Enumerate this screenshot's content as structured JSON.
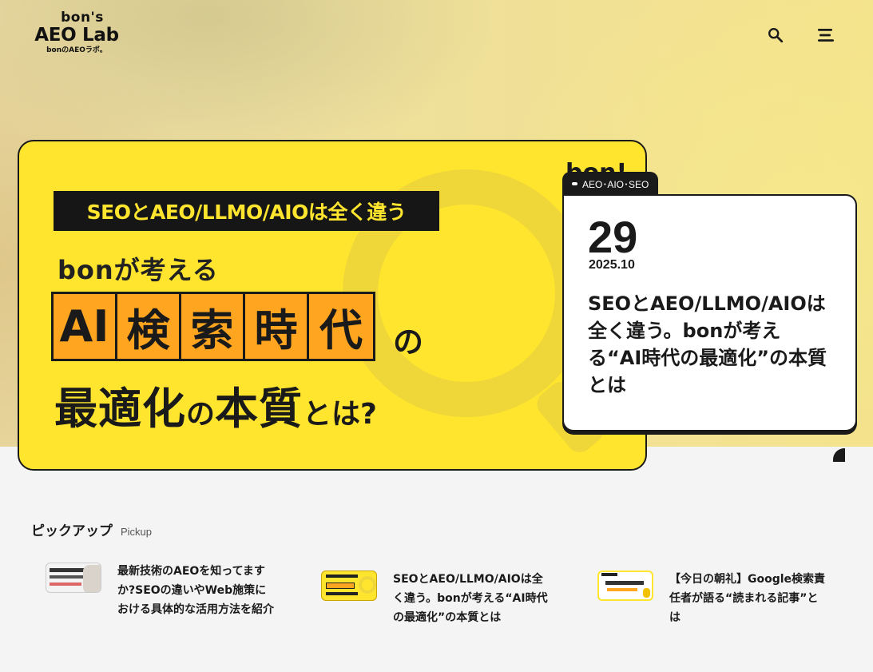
{
  "header": {
    "logo_top": "bon's",
    "logo_main": "AEO Lab",
    "logo_sub": "bonのAEOラボ。",
    "search_icon": "search-icon",
    "menu_icon": "hamburger-menu-icon"
  },
  "hero": {
    "brand": "bon!",
    "band_text": "SEOとAEO/LLMO/AIOは全く違う",
    "lead": "bonが考える",
    "boxes": [
      "AI",
      "検",
      "索",
      "時",
      "代"
    ],
    "no_text": "の",
    "bottom_big1": "最適化",
    "bottom_small1": "の",
    "bottom_big2": "本質",
    "bottom_small2": "とは?"
  },
  "article": {
    "tag": "AEO･AIO･SEO",
    "day": "29",
    "year_month": "2025.10",
    "title": "SEOとAEO/LLMO/AIOは全く違う。bonが考える“AI時代の最適化”の本質とは"
  },
  "pickup": {
    "title": "ピックアップ",
    "title_en": "Pickup",
    "items": [
      {
        "title": "最新技術のAEOを知ってますか?SEOの違いやWeb施策における具体的な活用方法を紹介"
      },
      {
        "title": "SEOとAEO/LLMO/AIOは全く違う。bonが考える“AI時代の最適化”の本質とは"
      },
      {
        "title": "【今日の朝礼】Google検索責任者が語る“読まれる記事”とは"
      }
    ]
  },
  "colors": {
    "brand_yellow": "#ffe52e",
    "accent_orange": "#ffa51f",
    "ink": "#1a1a1a"
  }
}
